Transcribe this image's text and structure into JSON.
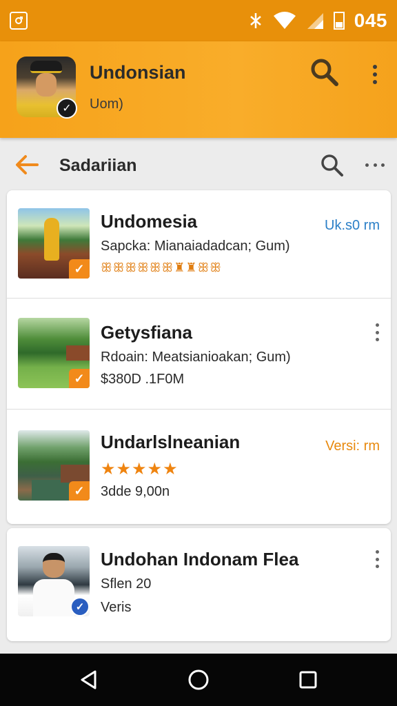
{
  "status_bar": {
    "time": "045",
    "icons": [
      "notification-icon",
      "bluetooth-icon",
      "wifi-icon",
      "signal-icon",
      "battery-icon"
    ]
  },
  "header": {
    "title": "Undonsian",
    "subtitle": "Uom)",
    "icons": [
      "search-icon",
      "more-vert-icon"
    ]
  },
  "toolbar": {
    "title": "Sadariian",
    "icons": [
      "back-arrow-icon",
      "search-icon",
      "more-horiz-icon"
    ]
  },
  "items": [
    {
      "title": "Undomesia",
      "line1": "Sapcka: Mianaiadadcan; Gum)",
      "glyphs": "ꕥꕥꕥꕥꕥꕥ♜♜ꕥꕥ",
      "tag": "Uk.s0 rm",
      "tag_color": "#2b7fc7"
    },
    {
      "title": "Getysfiana",
      "line1": "Rdoain: Meatsianioakan; Gum)",
      "line2": "$380D .1F0M"
    },
    {
      "title": "Undarlslneanian",
      "rating": 5,
      "line2": "3dde 9,00n",
      "tag": "Versi: rm",
      "tag_color": "#e8890d"
    },
    {
      "title": "Undohan Indonam Flea",
      "line1": "Sflen 20",
      "line2": "Veris"
    }
  ],
  "colors": {
    "status_bar": "#e8900a",
    "header": "#f9ad2a",
    "accent_orange": "#f28a1a",
    "accent_blue": "#2b7fc7",
    "nav_bar": "#060606"
  }
}
